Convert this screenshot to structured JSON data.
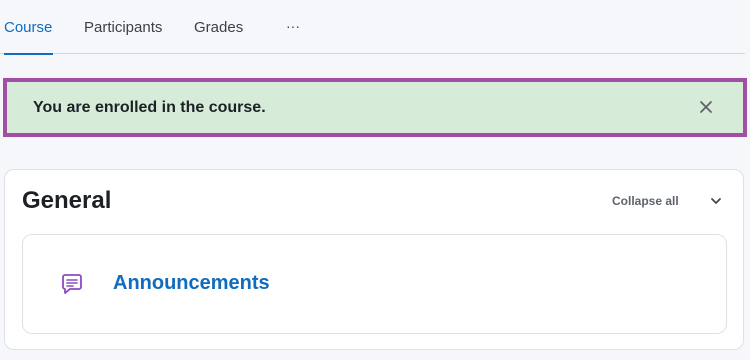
{
  "tabs": [
    {
      "label": "Course",
      "active": true
    },
    {
      "label": "Participants",
      "active": false
    },
    {
      "label": "Grades",
      "active": false
    },
    {
      "label": "···",
      "active": false
    }
  ],
  "alert": {
    "message": "You are enrolled in the course.",
    "close_icon": "close-icon",
    "background": "#d6ecd9",
    "border": "#a04fa5"
  },
  "section": {
    "title": "General",
    "collapse_label": "Collapse all",
    "chevron_icon": "chevron-down-icon"
  },
  "activity": {
    "name": "Announcements",
    "icon": "forum-icon",
    "icon_color": "#8d4bc2"
  },
  "colors": {
    "accent": "#0f6cbf"
  }
}
